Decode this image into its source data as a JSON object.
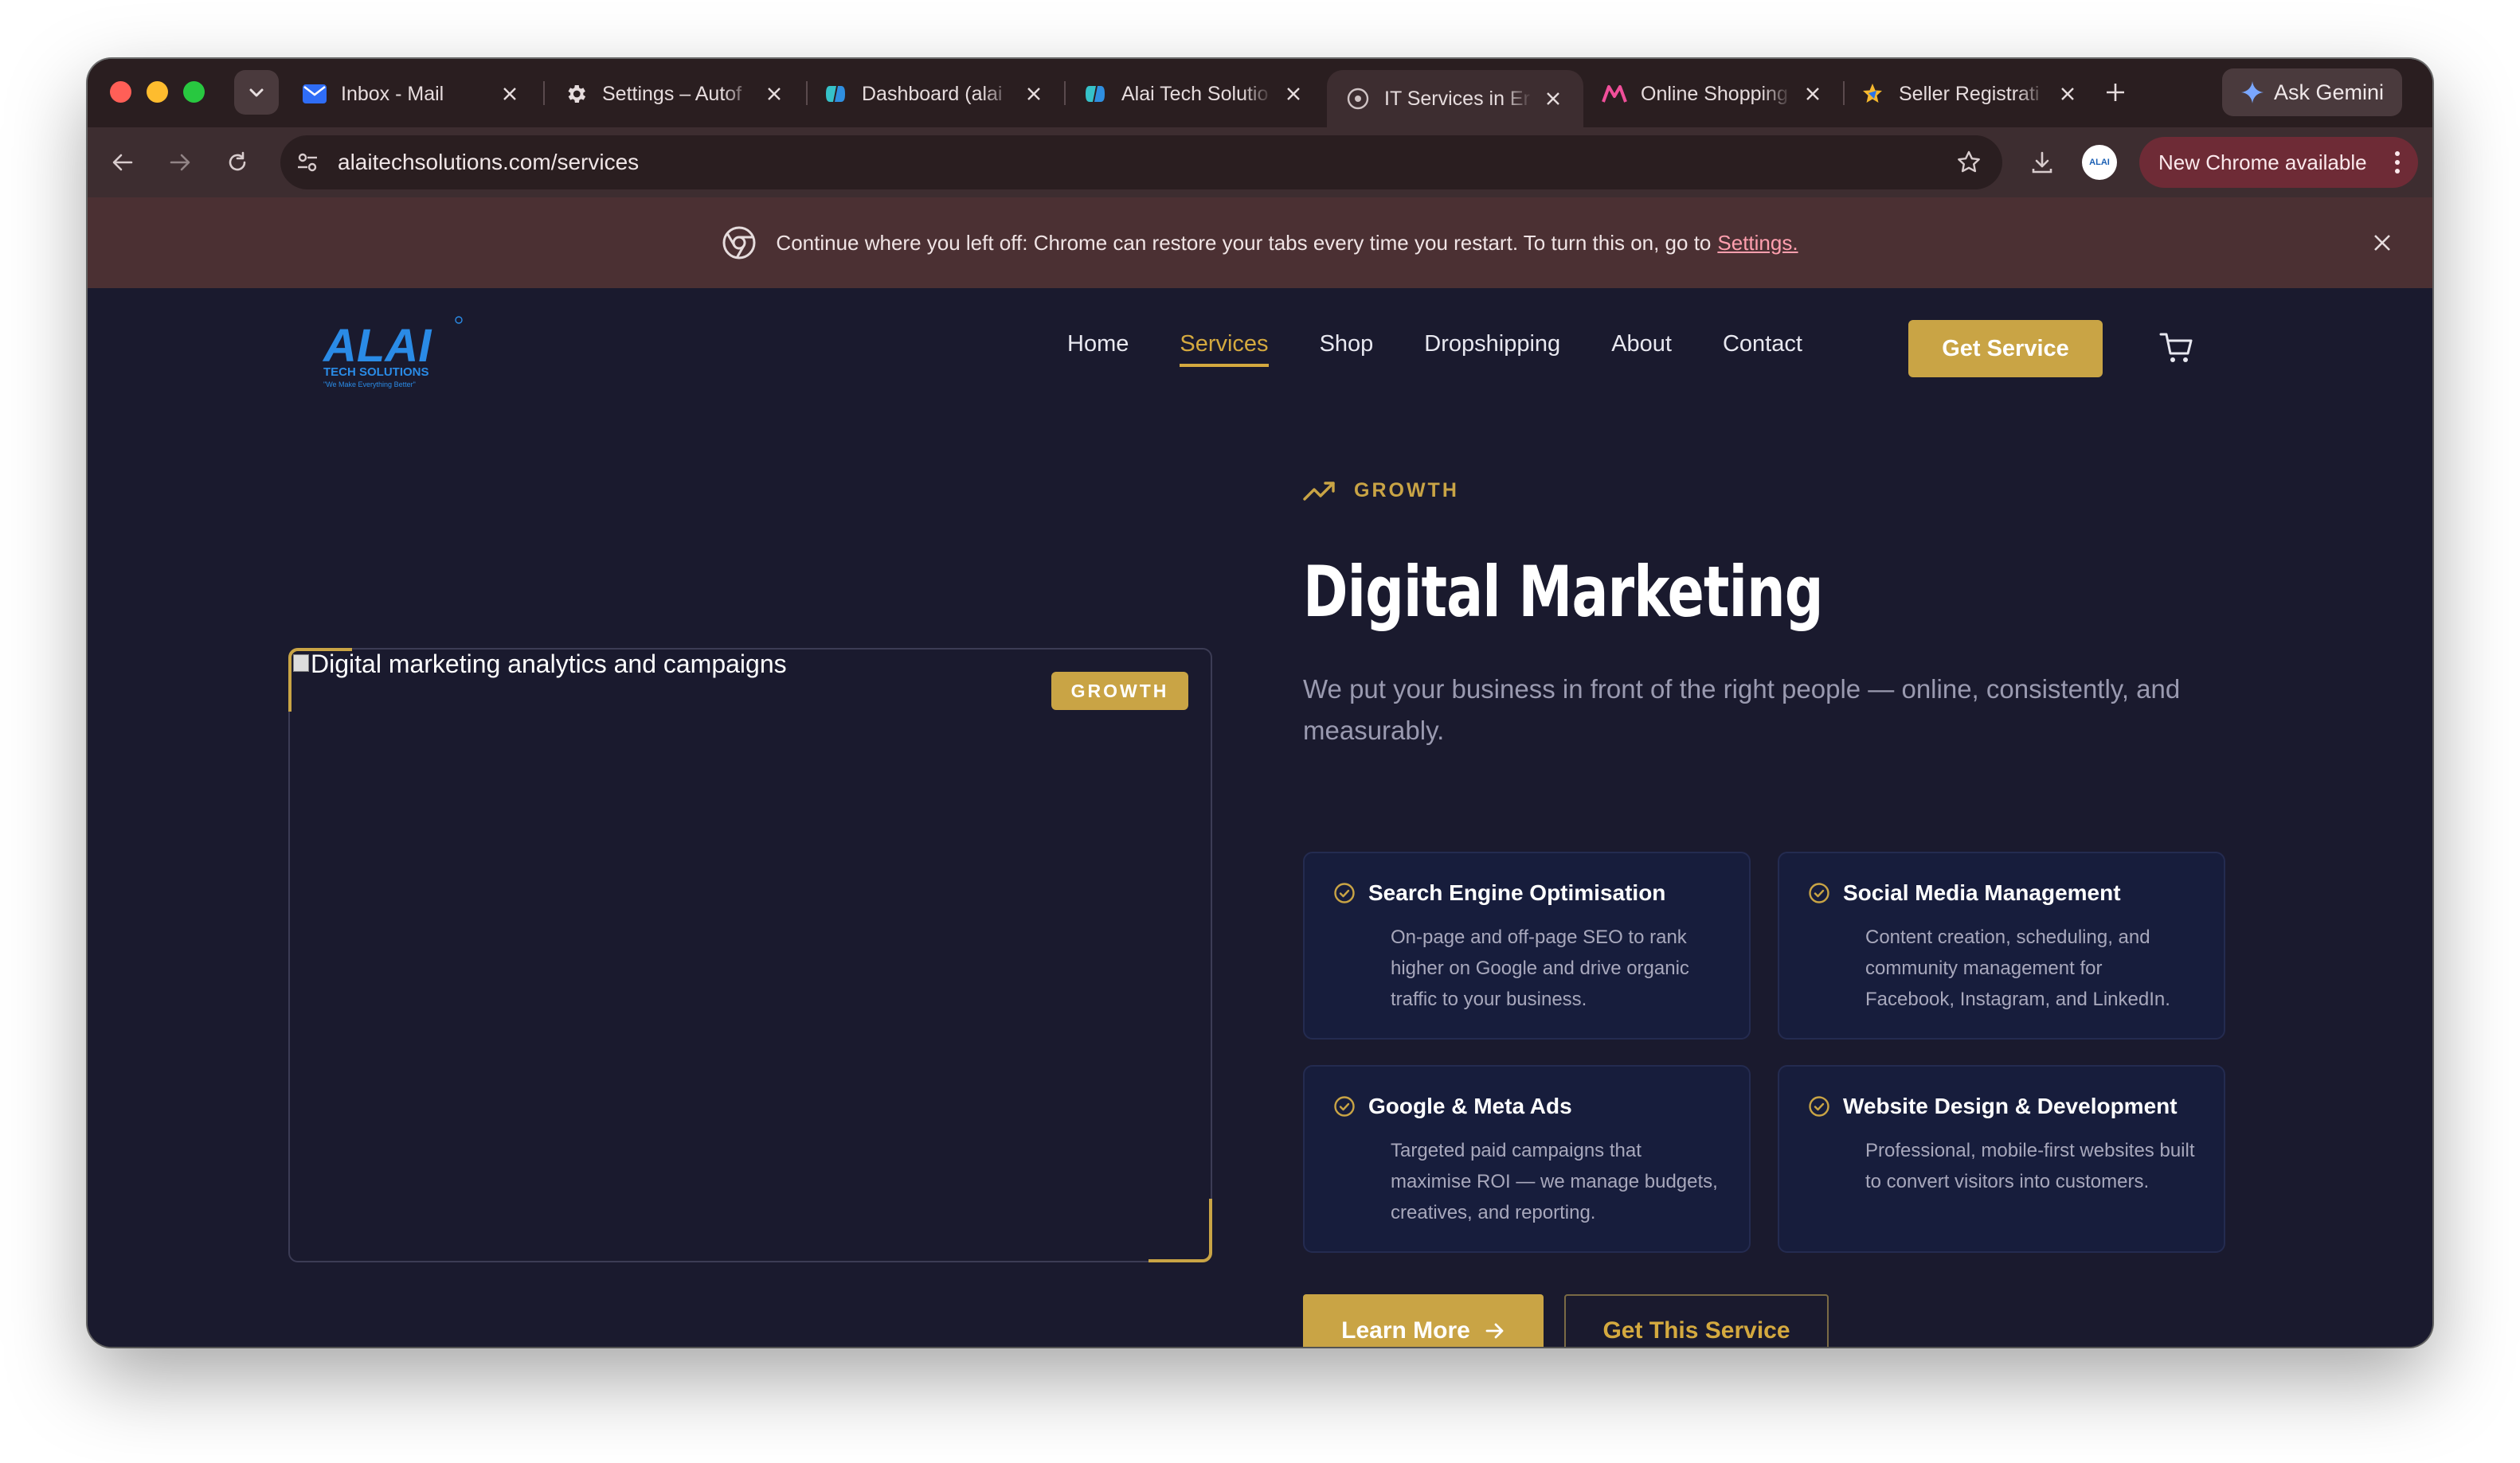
{
  "browser": {
    "tabs": [
      {
        "title": "Inbox - Mail",
        "icon": "mail-icon",
        "active": false
      },
      {
        "title": "Settings – Autof",
        "icon": "gear-icon",
        "active": false
      },
      {
        "title": "Dashboard (alai",
        "icon": "copilot-icon",
        "active": false
      },
      {
        "title": "Alai Tech Solutio",
        "icon": "copilot-icon",
        "active": false
      },
      {
        "title": "IT Services in Er",
        "icon": "globe-icon",
        "active": true
      },
      {
        "title": "Online Shopping",
        "icon": "meesho-icon",
        "active": false
      },
      {
        "title": "Seller Registrati",
        "icon": "flipkart-icon",
        "active": false
      }
    ],
    "ask_gemini": "Ask Gemini",
    "url": "alaitechsolutions.com/services",
    "update_button": "New Chrome available",
    "profile_label": "ALAI",
    "infobar": {
      "message": "Continue where you left off: Chrome can restore your tabs every time you restart. To turn this on, go to",
      "link": "Settings."
    }
  },
  "site": {
    "logo": {
      "wordmark": "ALAI",
      "line1": "TECH SOLUTIONS",
      "tagline": "\"We Make Everything Better\""
    },
    "nav": [
      {
        "label": "Home",
        "active": false
      },
      {
        "label": "Services",
        "active": true
      },
      {
        "label": "Shop",
        "active": false
      },
      {
        "label": "Dropshipping",
        "active": false
      },
      {
        "label": "About",
        "active": false
      },
      {
        "label": "Contact",
        "active": false
      }
    ],
    "nav_cta": "Get Service",
    "hero": {
      "image_alt": "Digital marketing analytics and campaigns",
      "image_badge": "GROWTH",
      "eyebrow": "GROWTH",
      "title": "Digital Marketing",
      "lead": "We put your business in front of the right people — online, consistently, and measurably.",
      "features": [
        {
          "title": "Search Engine Optimisation",
          "body": "On-page and off-page SEO to rank higher on Google and drive organic traffic to your business."
        },
        {
          "title": "Social Media Management",
          "body": "Content creation, scheduling, and community management for Facebook, Instagram, and LinkedIn."
        },
        {
          "title": "Google & Meta Ads",
          "body": "Targeted paid campaigns that maximise ROI — we manage budgets, creatives, and reporting."
        },
        {
          "title": "Website Design & Development",
          "body": "Professional, mobile-first websites built to convert visitors into customers."
        }
      ],
      "primary_button": "Learn More",
      "secondary_button": "Get This Service"
    }
  },
  "colors": {
    "accent": "#c9a445",
    "background": "#1a1a2e",
    "card": "#171d3c"
  }
}
